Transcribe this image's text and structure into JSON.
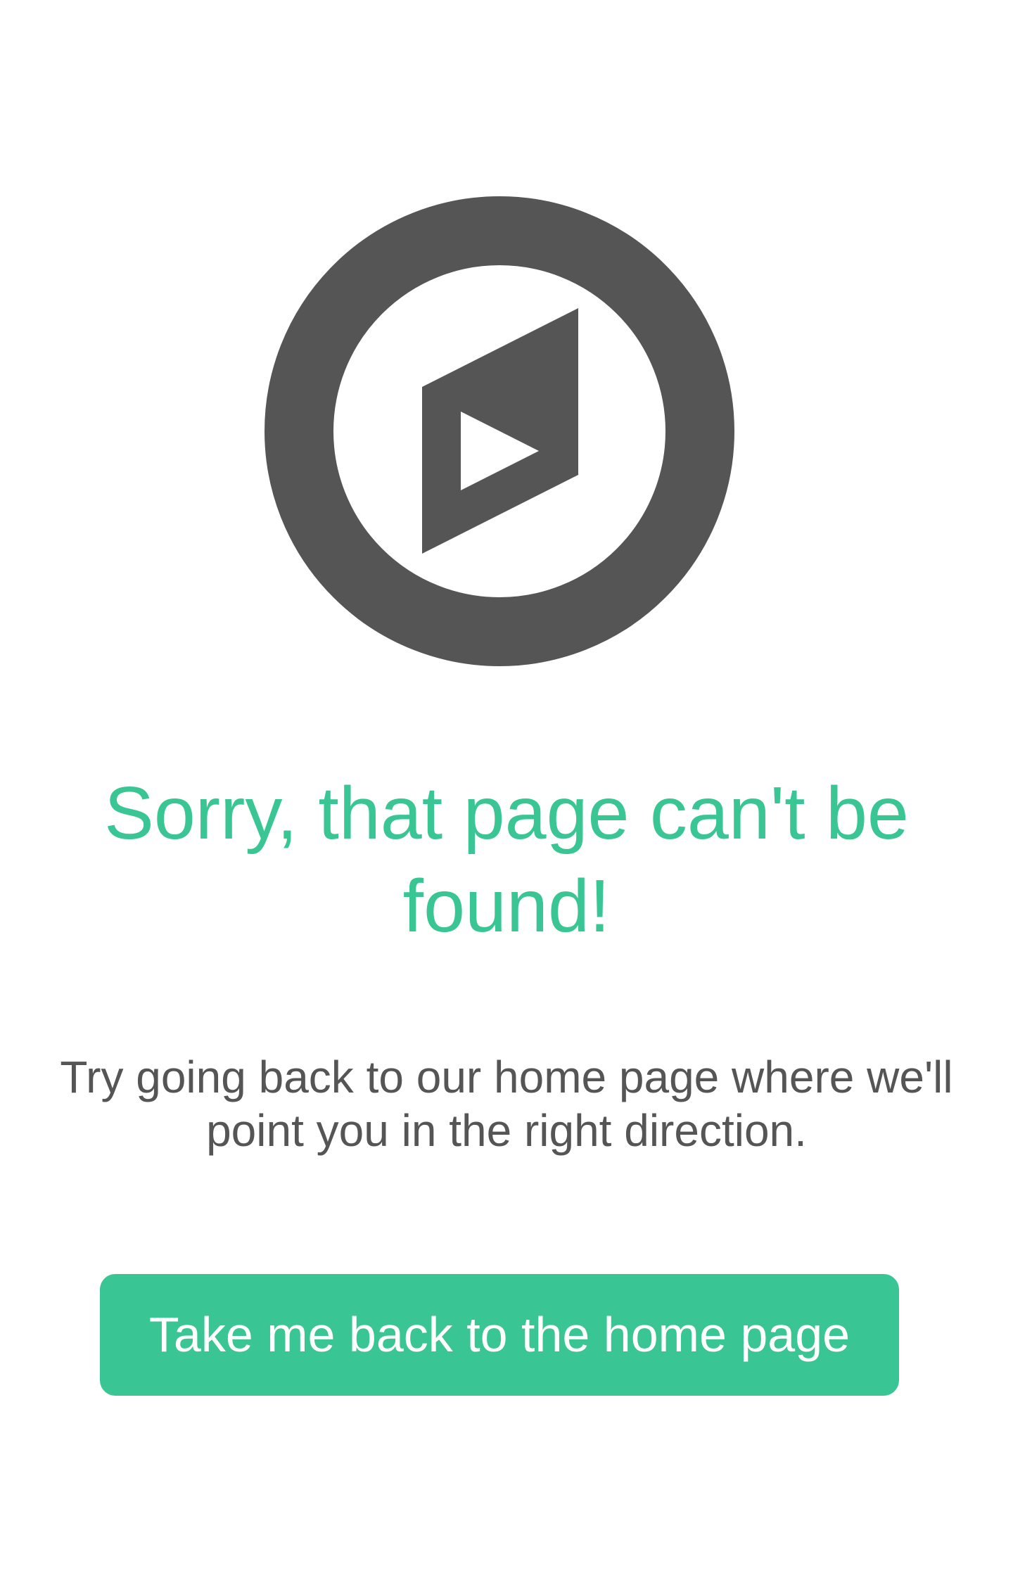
{
  "logo": {
    "icon": "play-circle-logo-icon",
    "color": "#555555"
  },
  "error": {
    "title": "Sorry, that page can't be found!",
    "message": "Try going back to our home page where we'll point you in the right direction.",
    "title_color": "#3ac594",
    "message_color": "#555555"
  },
  "home_button": {
    "label": "Take me back to the home page",
    "background": "#3ac594",
    "text_color": "#ffffff"
  }
}
